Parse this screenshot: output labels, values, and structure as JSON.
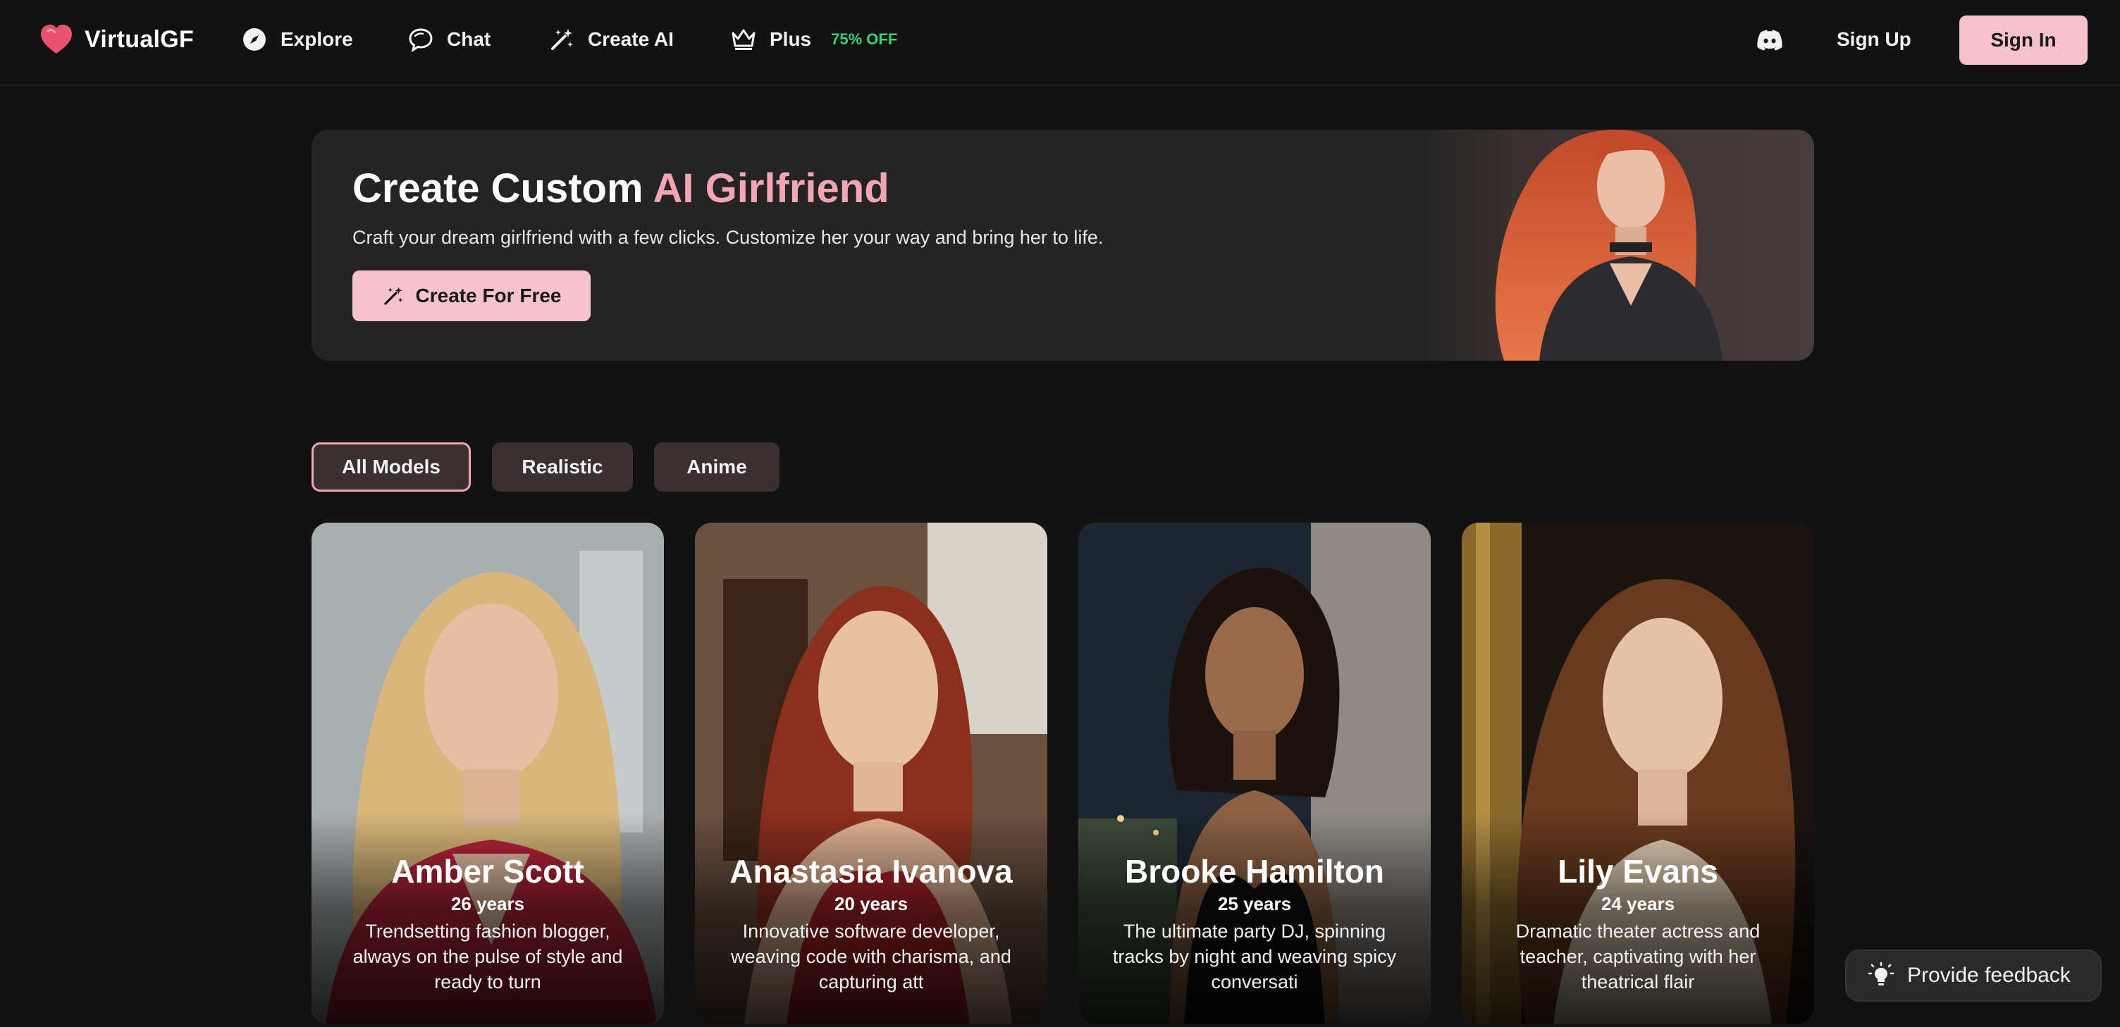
{
  "brand": {
    "name": "VirtualGF",
    "logo_icon": "heart-icon"
  },
  "nav": {
    "explore": "Explore",
    "chat": "Chat",
    "create_ai": "Create AI",
    "plus": "Plus",
    "plus_badge": "75% OFF",
    "sign_up": "Sign Up",
    "sign_in": "Sign In"
  },
  "hero": {
    "title_main": "Create Custom ",
    "title_accent": "AI Girlfriend",
    "subtitle": "Craft your dream girlfriend with a few clicks. Customize her your way and bring her to life.",
    "button": "Create For Free"
  },
  "filters": [
    {
      "label": "All Models",
      "active": true
    },
    {
      "label": "Realistic",
      "active": false
    },
    {
      "label": "Anime",
      "active": false
    }
  ],
  "cards": [
    {
      "name": "Amber Scott",
      "age": "26 years",
      "description": "Trendsetting fashion blogger, always on the pulse of style and ready to turn"
    },
    {
      "name": "Anastasia Ivanova",
      "age": "20 years",
      "description": "Innovative software developer, weaving code with charisma, and capturing att"
    },
    {
      "name": "Brooke Hamilton",
      "age": "25 years",
      "description": "The ultimate party DJ, spinning tracks by night and weaving spicy conversati"
    },
    {
      "name": "Lily Evans",
      "age": "24 years",
      "description": "Dramatic theater actress and teacher, captivating with her theatrical flair"
    }
  ],
  "feedback": {
    "label": "Provide feedback"
  },
  "colors": {
    "accent": "#f4a5b4",
    "button": "#f6c2cd",
    "badge": "#34d27a",
    "background": "#121212"
  }
}
